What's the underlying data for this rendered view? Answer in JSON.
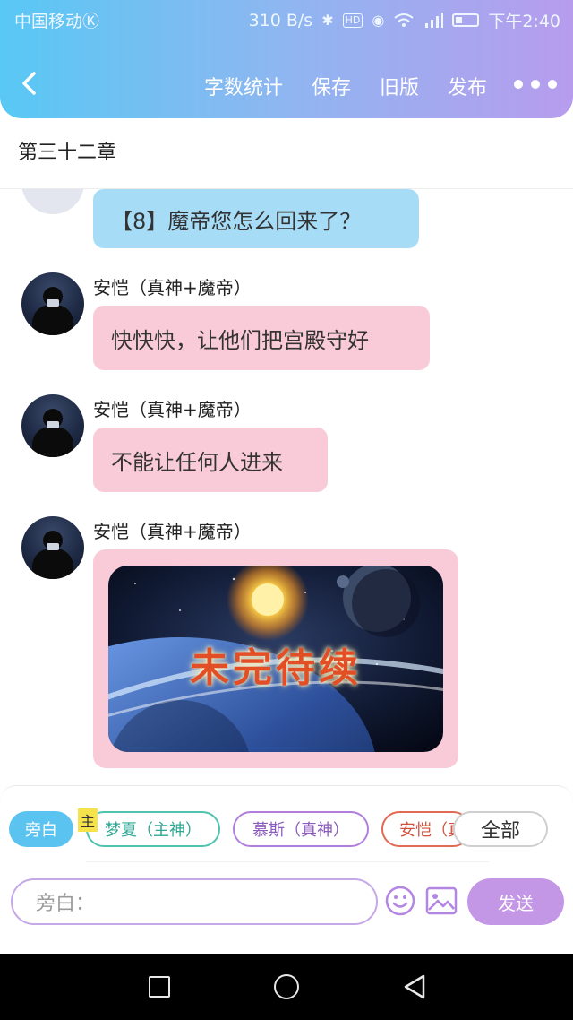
{
  "status_bar": {
    "carrier": "中国移动",
    "carrier_badge": "Ⓚ",
    "speed": "310 B/s",
    "time": "下午2:40",
    "icons": [
      "bluetooth-icon",
      "hd-icon",
      "eye-icon",
      "wifi-icon",
      "signal-icon",
      "battery-icon"
    ]
  },
  "nav": {
    "back_icon": "chevron-left-icon",
    "actions": [
      "字数统计",
      "保存",
      "旧版",
      "发布"
    ],
    "more_icon": "more-dots-icon"
  },
  "chapter_title": "第三十二章",
  "messages": [
    {
      "type": "text",
      "bubble_color": "blue",
      "text": "【8】魔帝您怎么回来了？"
    },
    {
      "type": "text",
      "bubble_color": "pink",
      "sender": "安恺（真神+魔帝）",
      "text": "快快快，让他们把宫殿守好"
    },
    {
      "type": "text",
      "bubble_color": "pink",
      "sender": "安恺（真神+魔帝）",
      "text": "不能让任何人进来"
    },
    {
      "type": "image",
      "bubble_color": "pink",
      "sender": "安恺（真神+魔帝）",
      "image_caption": "未完待续"
    }
  ],
  "roles": {
    "narration": "旁白",
    "host_tag": "主",
    "chips": [
      "梦夏（主神）",
      "慕斯（真神）",
      "安恺（真神+魔帝）"
    ],
    "all_button": "全部"
  },
  "composer": {
    "placeholder": "旁白：",
    "emoji_icon": "emoji-icon",
    "image_icon": "image-icon",
    "send_label": "发送"
  },
  "colors": {
    "header_gradient_start": "#58c8f4",
    "header_gradient_end": "#b79cee",
    "bubble_blue": "#a7dcf7",
    "bubble_pink": "#f9cbd8",
    "send_button": "#c396e6",
    "chip_teal": "#4fc3ae",
    "chip_purple": "#b07fdc",
    "chip_red": "#e06a54"
  }
}
